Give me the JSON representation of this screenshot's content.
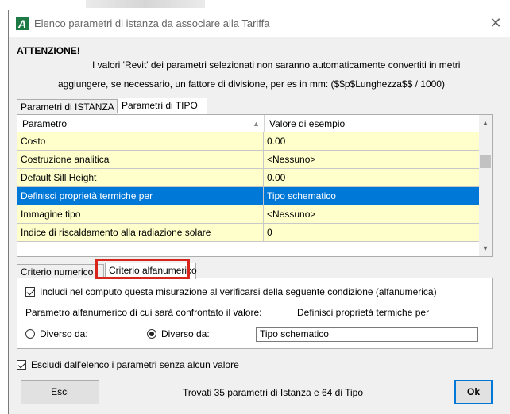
{
  "window": {
    "title": "Elenco parametri di istanza da associare alla Tariffa",
    "icon_letter": "A",
    "brand_color": "#1e7a45"
  },
  "warning": {
    "title": "ATTENZIONE!",
    "line1": "I valori 'Revit' dei parametri selezionati non saranno automaticamente convertiti in metri",
    "line2": "aggiungere, se necessario, un fattore di divisione, per es in mm: ($$p$Lunghezza$$ / 1000)"
  },
  "param_tabs": [
    {
      "label": "Parametri di ISTANZA",
      "active": false
    },
    {
      "label": "Parametri di TIPO",
      "active": true
    }
  ],
  "grid": {
    "columns": [
      "Parametro",
      "Valore di esempio"
    ],
    "rows": [
      {
        "name": "Costo",
        "value": "0.00",
        "selected": false
      },
      {
        "name": "Costruzione analitica",
        "value": "<Nessuno>",
        "selected": false
      },
      {
        "name": "Default Sill Height",
        "value": "0.00",
        "selected": false
      },
      {
        "name": "Definisci proprietà termiche per",
        "value": "Tipo schematico",
        "selected": true
      },
      {
        "name": "Immagine tipo",
        "value": "<Nessuno>",
        "selected": false
      },
      {
        "name": "Indice di riscaldamento alla radiazione solare",
        "value": "0",
        "selected": false
      }
    ],
    "row_color": "#ffffcc",
    "selected_color": "#0078d7"
  },
  "criteria_tabs": [
    {
      "label": "Criterio numerico",
      "active": false
    },
    {
      "label": "Criterio alfanumerico",
      "active": true
    }
  ],
  "criteria": {
    "include_label": "Includi nel computo questa misurazione al verificarsi della seguente condizione (alfanumerica)",
    "param_label": "Parametro alfanumerico di cui sarà confrontato il valore:",
    "param_value": "Definisci proprietà termiche per",
    "radio1_label": "Diverso da:",
    "radio2_label": "Diverso da:",
    "compare_value": "Tipo schematico"
  },
  "footer": {
    "exclude_label": "Escludi dall'elenco i parametri senza alcun valore",
    "exit_label": "Esci",
    "status": "Trovati 35 parametri di Istanza e 64 di Tipo",
    "ok_label": "Ok"
  },
  "highlight_color": "#d9261c"
}
